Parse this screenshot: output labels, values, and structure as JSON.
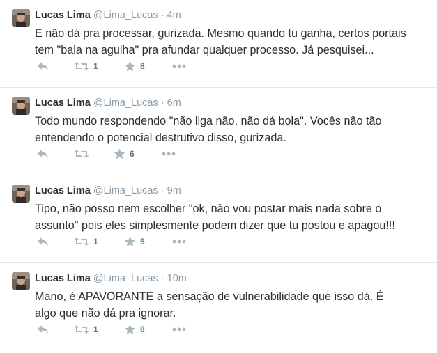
{
  "colors": {
    "text": "#292f33",
    "muted": "#8899a6",
    "icon": "#aab8c2",
    "count": "#66757f",
    "divider": "#e1e8ed"
  },
  "icons": {
    "reply": "reply-icon",
    "retweet": "retweet-icon",
    "favorite": "star-icon",
    "more": "more-dots-icon"
  },
  "tweets": [
    {
      "fullname": "Lucas Lima",
      "username": "@Lima_Lucas",
      "separator": "·",
      "time": "4m",
      "text": "E não dá pra processar, gurizada. Mesmo quando tu ganha, certos portais\ntem \"bala na agulha\" pra afundar qualquer processo. Já pesquisei...",
      "retweets": "1",
      "favorites": "8"
    },
    {
      "fullname": "Lucas Lima",
      "username": "@Lima_Lucas",
      "separator": "·",
      "time": "6m",
      "text": "Todo mundo respondendo \"não liga não, não dá bola\". Vocês não tão\nentendendo o potencial destrutivo disso, gurizada.",
      "retweets": "",
      "favorites": "6"
    },
    {
      "fullname": "Lucas Lima",
      "username": "@Lima_Lucas",
      "separator": "·",
      "time": "9m",
      "text": "Tipo, não posso nem escolher \"ok, não vou postar mais nada sobre o\nassunto\" pois eles simplesmente podem dizer que tu postou e apagou!!!",
      "retweets": "1",
      "favorites": "5"
    },
    {
      "fullname": "Lucas Lima",
      "username": "@Lima_Lucas",
      "separator": "·",
      "time": "10m",
      "text": "Mano, é APAVORANTE a sensação de vulnerabilidade que isso dá. É\nalgo que não dá pra ignorar.",
      "retweets": "1",
      "favorites": "8"
    }
  ]
}
